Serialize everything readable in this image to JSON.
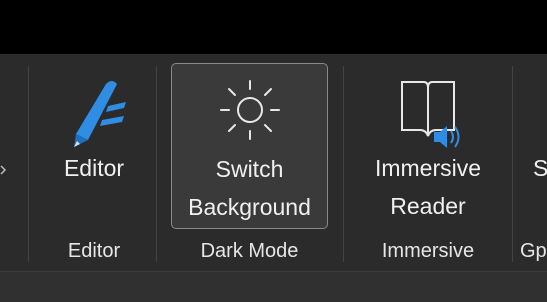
{
  "ribbon": {
    "buttons": {
      "editor": {
        "label": "Editor",
        "icon": "editor-pen-icon"
      },
      "switch_background": {
        "label_line1": "Switch",
        "label_line2": "Background",
        "icon": "sun-icon"
      },
      "immersive_reader": {
        "label_line1": "Immersive",
        "label_line2": "Reader",
        "icon": "immersive-reader-icon"
      },
      "cut_off_right": {
        "label": "S"
      }
    },
    "groups": {
      "editor": "Editor",
      "dark_mode": "Dark Mode",
      "immersive": "Immersive",
      "cut_off_right": "Gp"
    }
  },
  "colors": {
    "ribbon_background": "#2b2b2b",
    "titlebar_background": "#000000",
    "editor_icon_blue": "#2f8de4",
    "speaker_blue": "#2f8de4",
    "text": "#f0f0f0"
  }
}
